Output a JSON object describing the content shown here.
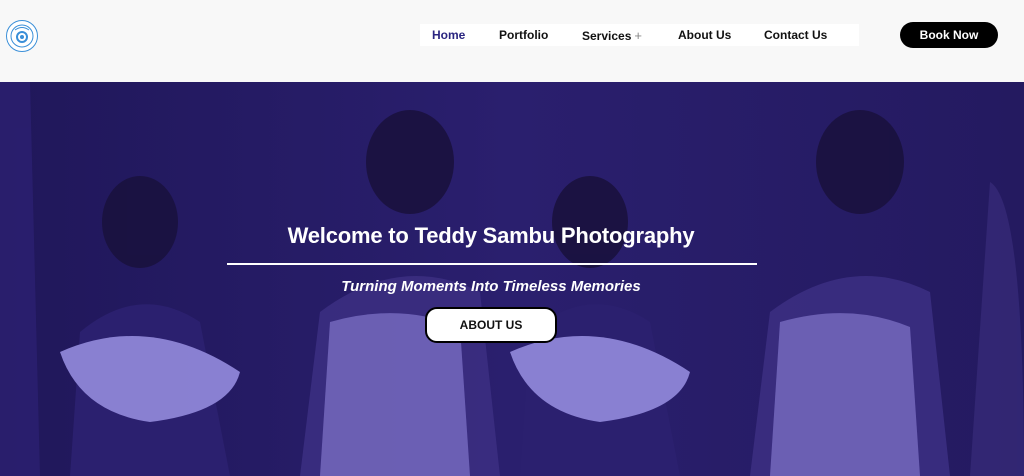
{
  "header": {
    "logo_icon": "teddy-sambu-logo-icon",
    "nav": [
      {
        "label": "Home",
        "active": true
      },
      {
        "label": "Portfolio",
        "active": false
      },
      {
        "label": "Services",
        "active": false,
        "has_submenu": true
      },
      {
        "label": "About Us",
        "active": false
      },
      {
        "label": "Contact Us",
        "active": false
      }
    ],
    "submenu_symbol": "+",
    "book_label": "Book Now"
  },
  "hero": {
    "title": "Welcome to Teddy Sambu Photography",
    "subtitle": "Turning Moments Into Timeless Memories",
    "button_label": "ABOUT US",
    "overlay_color": "#2b1f78"
  },
  "colors": {
    "header_bg": "#f8f8f8",
    "active_nav": "#2a2580",
    "button_dark": "#000000"
  }
}
